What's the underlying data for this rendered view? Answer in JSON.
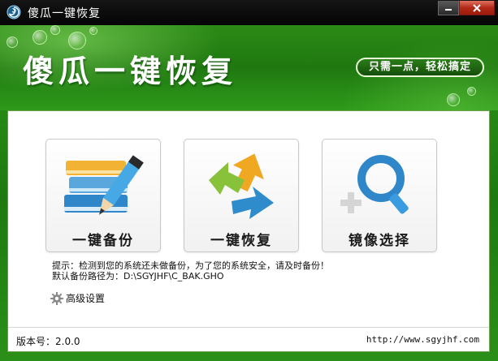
{
  "window": {
    "title": "傻瓜一键恢复",
    "minimize_label": "minimize",
    "close_label": "close"
  },
  "banner": {
    "title": "傻瓜一键恢复",
    "slogan": "只需一点，轻松搞定"
  },
  "actions": [
    {
      "label": "一键备份",
      "icon": "books-pencil-icon"
    },
    {
      "label": "一键恢复",
      "icon": "recycle-arrows-icon"
    },
    {
      "label": "镜像选择",
      "icon": "magnifier-icon"
    }
  ],
  "tip": {
    "line1": "提示：检测到您的系统还未做备份，为了您的系统安全，请及时备份！",
    "line2": "默认备份路径为：D:\\SGYJHF\\C_BAK.GHO"
  },
  "advanced": {
    "label": "高级设置",
    "icon": "gear-icon"
  },
  "footer": {
    "version": "版本号：2.0.0",
    "url": "http://www.sgyjhf.com"
  },
  "colors": {
    "accent_green": "#1e7a10",
    "title_bar": "#0a0a0a",
    "close_red": "#b42a18"
  }
}
